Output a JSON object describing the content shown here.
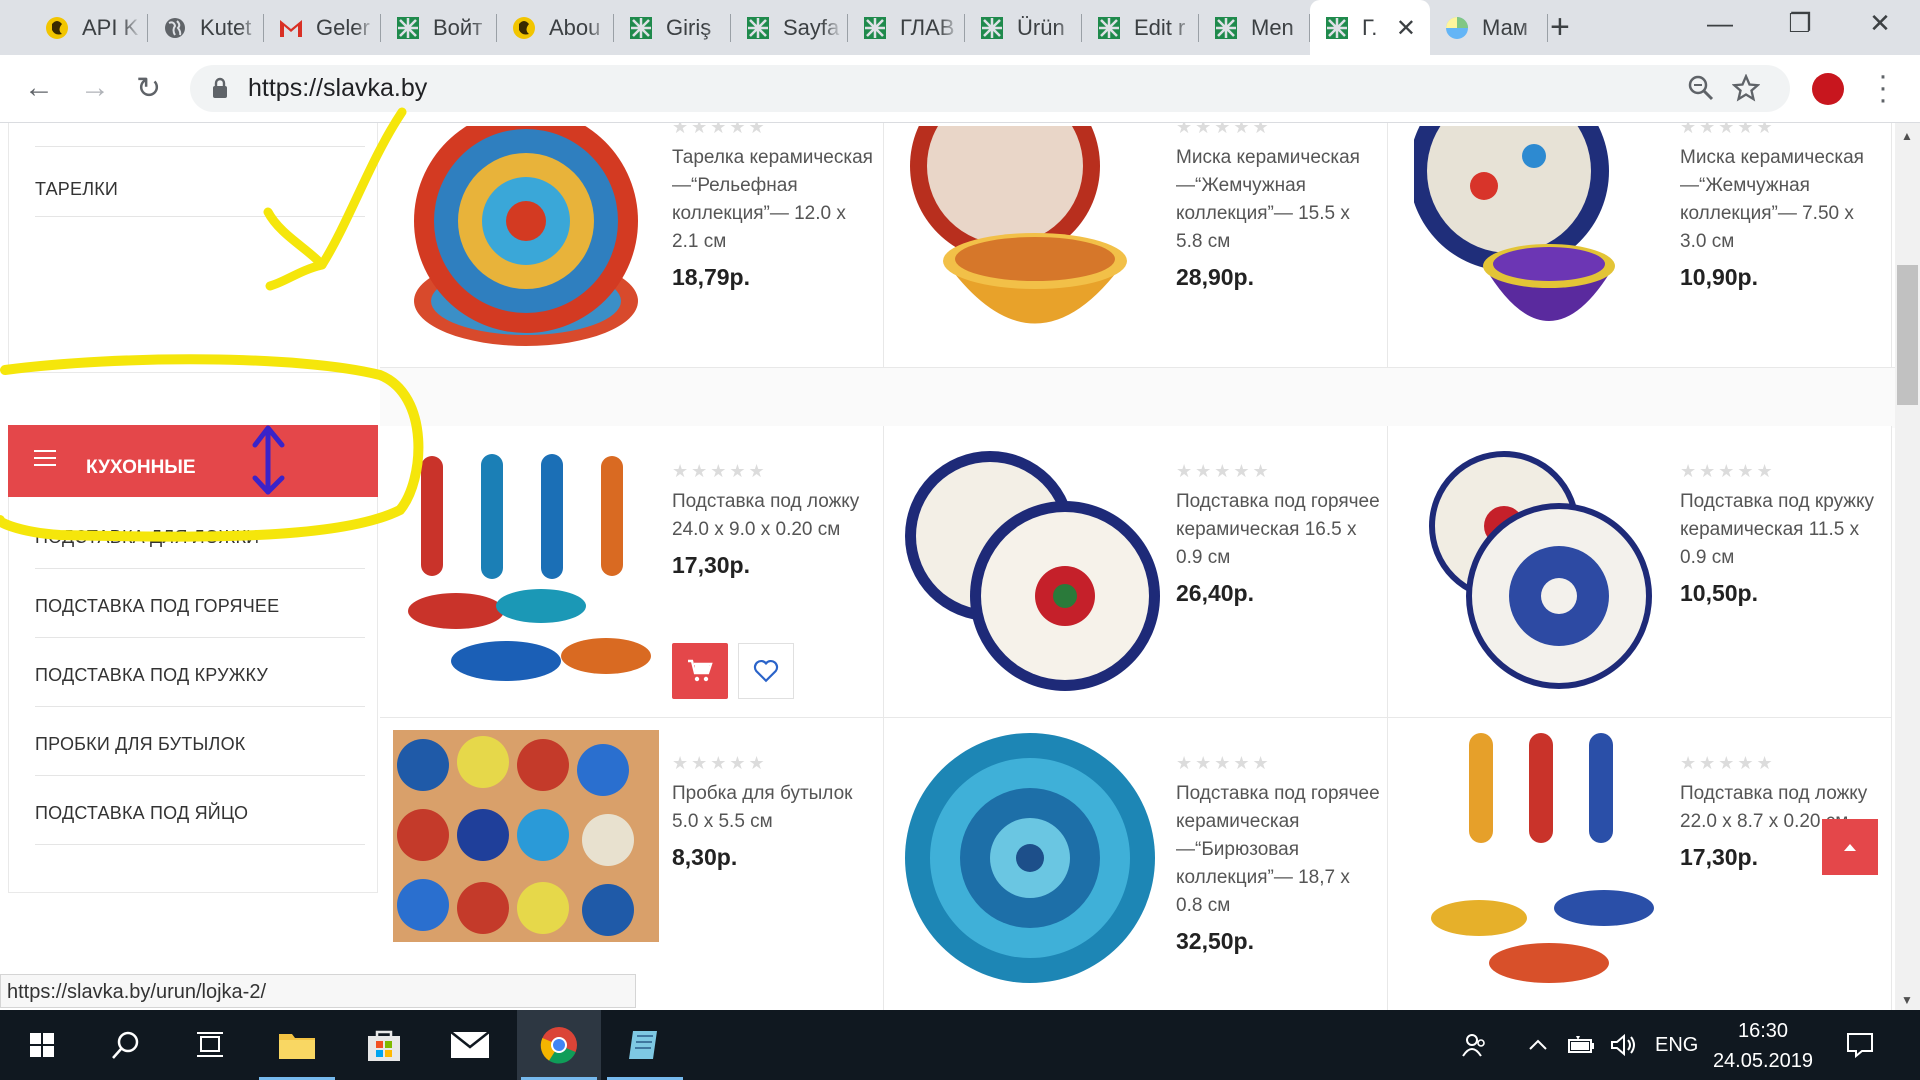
{
  "browser": {
    "tabs": [
      {
        "title": "API K",
        "icon": "yellow-logo-icon"
      },
      {
        "title": "Kutet",
        "icon": "globe-icon"
      },
      {
        "title": "Geler",
        "icon": "gmail-icon"
      },
      {
        "title": "Войт",
        "icon": "green-pattern-icon"
      },
      {
        "title": "Abou",
        "icon": "yellow-logo-icon"
      },
      {
        "title": "Giriş",
        "icon": "green-pattern-icon"
      },
      {
        "title": "Sayfa",
        "icon": "green-pattern-icon"
      },
      {
        "title": "ГЛАВ",
        "icon": "green-pattern-icon"
      },
      {
        "title": "Ürün",
        "icon": "green-pattern-icon"
      },
      {
        "title": "Edit r",
        "icon": "green-pattern-icon"
      },
      {
        "title": "Men",
        "icon": "green-pattern-icon"
      },
      {
        "title": "Г.",
        "icon": "green-pattern-icon",
        "active": true
      },
      {
        "title": "Мам",
        "icon": "colorful-circle-icon"
      }
    ],
    "url": "https://slavka.by",
    "status_url": "https://slavka.by/urun/lojka-2/"
  },
  "sidebar": {
    "top_item": "ТАРЕЛКИ",
    "category_title": "КУХОННЫЕ ПРИНАДЛЕЖНОСТИ",
    "items": [
      "ПОДСТАВКА ДЛЯ ЛОЖКИ",
      "ПОДСТАВКА ПОД ГОРЯЧЕЕ",
      "ПОДСТАВКА ПОД КРУЖКУ",
      "ПРОБКИ ДЛЯ БУТЫЛОК",
      "ПОДСТАВКА ПОД ЯЙЦО"
    ]
  },
  "products": [
    {
      "name": "Тарелка керамическая —“Рельефная коллекция”— 12.0 x 2.1 см",
      "price": "18,79р."
    },
    {
      "name": "Миска керамическая —“Жемчужная коллекция”— 15.5 x 5.8 см",
      "price": "28,90р."
    },
    {
      "name": "Миска керамическая —“Жемчужная коллекция”— 7.50 x 3.0 см",
      "price": "10,90р."
    },
    {
      "name": "Подставка под ложку 24.0 x 9.0 x 0.20 см",
      "price": "17,30р."
    },
    {
      "name": "Подставка под горячее керамическая 16.5 x 0.9 см",
      "price": "26,40р."
    },
    {
      "name": "Подставка под кружку керамическая 11.5 x 0.9 см",
      "price": "10,50р."
    },
    {
      "name": "Пробка для бутылок 5.0 x 5.5 см",
      "price": "8,30р."
    },
    {
      "name": "Подставка под горячее керамическая —“Бирюзовая коллекция”— 18,7 x 0.8 см",
      "price": "32,50р."
    },
    {
      "name": "Подставка под ложку 22.0 x 8.7 x 0.20 см",
      "price": "17,30р."
    }
  ],
  "stars": "★★★★★",
  "taskbar": {
    "language": "ENG",
    "time": "16:30",
    "date": "24.05.2019"
  },
  "colors": {
    "accent": "#e4474a",
    "annotation_yellow": "#f5e60b",
    "annotation_purple": "#3a23c9"
  }
}
